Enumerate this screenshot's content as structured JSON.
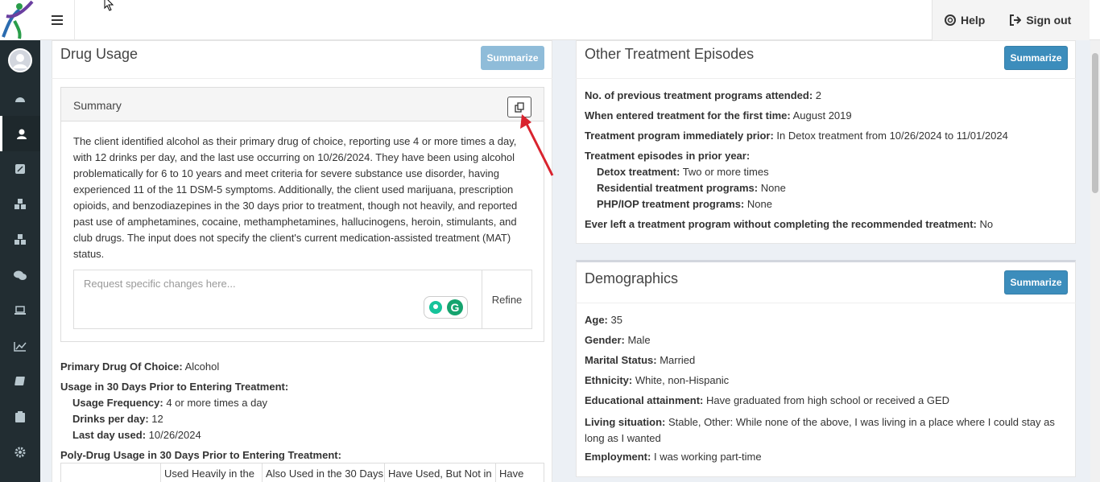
{
  "topbar": {
    "help_label": "Help",
    "signout_label": "Sign out"
  },
  "drug_usage": {
    "title": "Drug Usage",
    "summarize_label": "Summarize",
    "summary_heading": "Summary",
    "summary_text": "The client identified alcohol as their primary drug of choice, reporting use 4 or more times a day, with 12 drinks per day, and the last use occurring on 10/26/2024. They have been using alcohol problematically for 6 to 10 years and meet criteria for severe substance use disorder, having experienced 11 of the 11 DSM-5 symptoms. Additionally, the client used marijuana, prescription opioids, and benzodiazepines in the 30 days prior to treatment, though not heavily, and reported past use of amphetamines, cocaine, methamphetamines, hallucinogens, heroin, stimulants, and club drugs. The input does not specify the client's current medication-assisted treatment (MAT) status.",
    "refine_placeholder": "Request specific changes here...",
    "refine_label": "Refine",
    "primary_drug_label": "Primary Drug Of Choice:",
    "primary_drug_value": "Alcohol",
    "usage_heading": "Usage in 30 Days Prior to Entering Treatment:",
    "usage_freq_label": "Usage Frequency:",
    "usage_freq_value": "4 or more times a day",
    "drinks_label": "Drinks per day:",
    "drinks_value": "12",
    "last_day_label": "Last day used:",
    "last_day_value": "10/26/2024",
    "poly_heading": "Poly-Drug Usage in 30 Days Prior to Entering Treatment:",
    "poly_columns": [
      "",
      "Used Heavily in the",
      "Also Used in the 30 Days",
      "Have Used, But Not in",
      "Have"
    ]
  },
  "other_treatment": {
    "title": "Other Treatment Episodes",
    "summarize_label": "Summarize",
    "prev_programs_label": "No. of previous treatment programs attended:",
    "prev_programs_value": "2",
    "first_time_label": "When entered treatment for the first time:",
    "first_time_value": "August 2019",
    "prior_program_label": "Treatment program immediately prior:",
    "prior_program_value": "In Detox treatment from 10/26/2024 to 11/01/2024",
    "episodes_heading": "Treatment episodes in prior year:",
    "detox_label": "Detox treatment:",
    "detox_value": "Two or more times",
    "residential_label": "Residential treatment programs:",
    "residential_value": "None",
    "php_label": "PHP/IOP treatment programs:",
    "php_value": "None",
    "left_label": "Ever left a treatment program without completing the recommended treatment:",
    "left_value": "No"
  },
  "demographics": {
    "title": "Demographics",
    "summarize_label": "Summarize",
    "age_label": "Age:",
    "age_value": "35",
    "gender_label": "Gender:",
    "gender_value": "Male",
    "marital_label": "Marital Status:",
    "marital_value": "Married",
    "ethnicity_label": "Ethnicity:",
    "ethnicity_value": "White, non-Hispanic",
    "education_label": "Educational attainment:",
    "education_value": "Have graduated from high school or received a GED",
    "living_label": "Living situation:",
    "living_value": "Stable, Other: While none of the above, I was living in a place where I could stay as long as I wanted",
    "employment_label": "Employment:",
    "employment_value": "I was working part-time"
  },
  "colors": {
    "accent": "#3c8dbc",
    "sidebar": "#222d32",
    "annotation_arrow": "#d9232e"
  }
}
